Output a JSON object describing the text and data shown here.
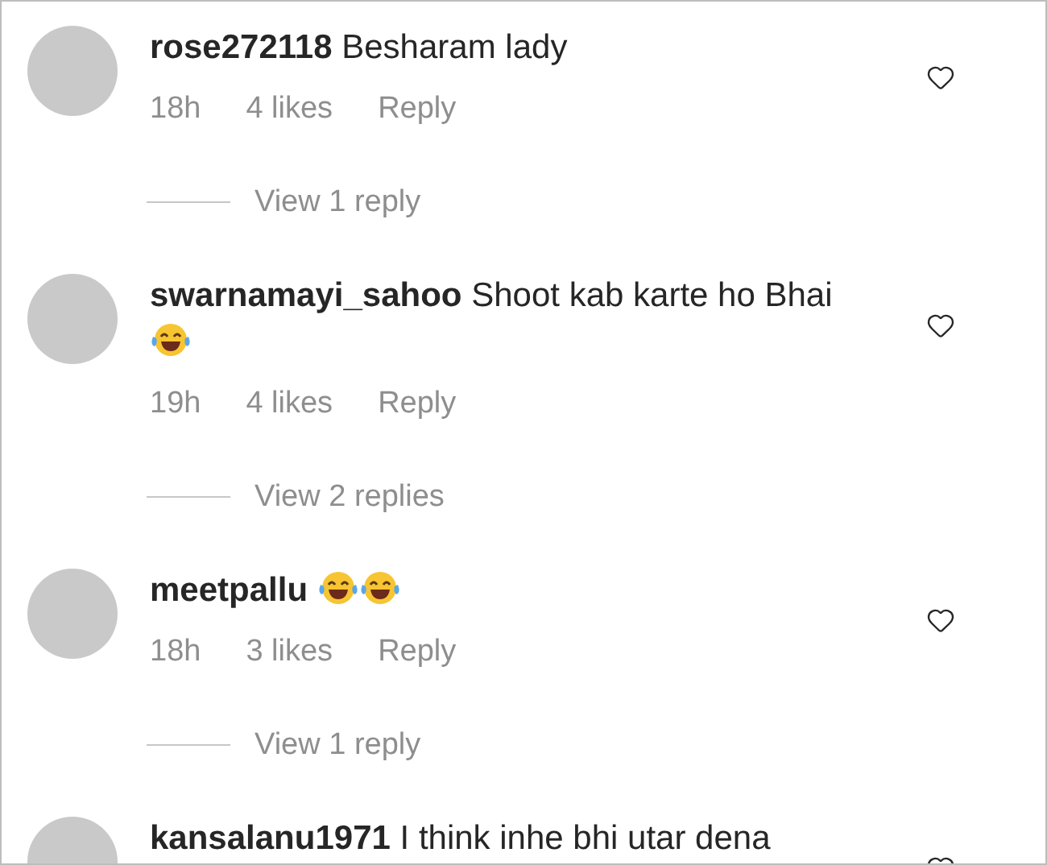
{
  "comments": [
    {
      "username": "rose272118",
      "text": "Besharam lady",
      "time": "18h",
      "likes": "4 likes",
      "reply": "Reply",
      "view_replies": "View 1 reply"
    },
    {
      "username": "swarnamayi_sahoo",
      "text": "Shoot kab karte ho Bhai",
      "reactions": [
        {
          "kind": "laughing"
        }
      ],
      "time": "19h",
      "likes": "4 likes",
      "reply": "Reply",
      "view_replies": "View 2 replies"
    },
    {
      "username": "meetpallu",
      "reactions": [
        {
          "kind": "laughing"
        },
        {
          "kind": "laughing"
        }
      ],
      "time": "18h",
      "likes": "3 likes",
      "reply": "Reply",
      "view_replies": "View 1 reply"
    },
    {
      "username": "kansalanu1971",
      "text": "I think inhe bhi utar dena"
    }
  ]
}
